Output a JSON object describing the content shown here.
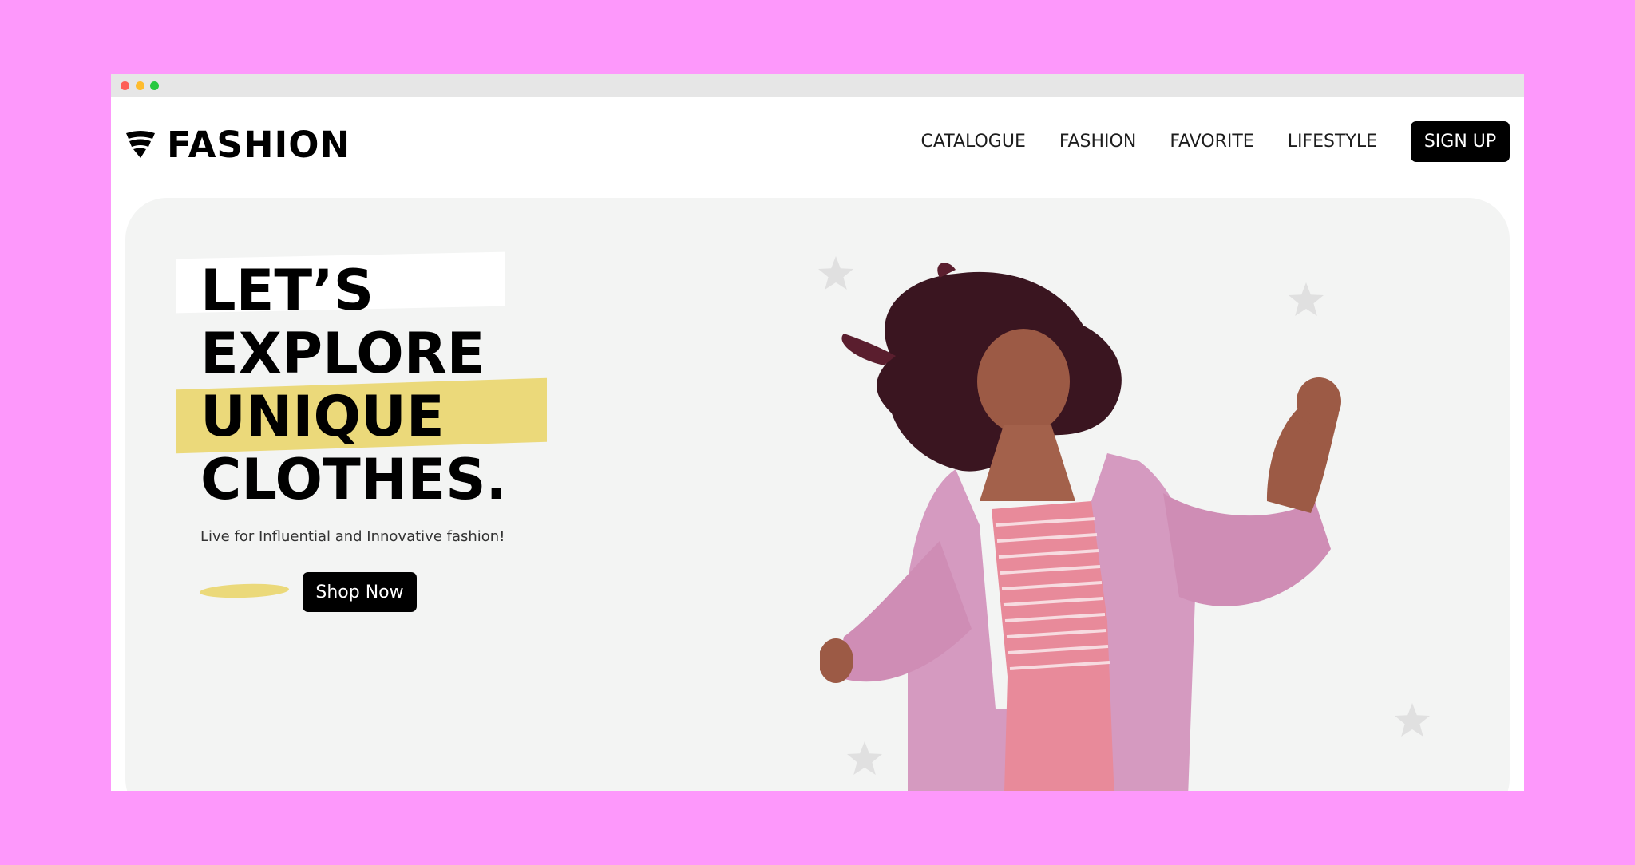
{
  "brand": {
    "name": "FASHION"
  },
  "nav": {
    "items": [
      "CATALOGUE",
      "FASHION",
      "FAVORITE",
      "LIFESTYLE"
    ],
    "signup_label": "SIGN UP"
  },
  "hero": {
    "headline": [
      "LET’S",
      "EXPLORE",
      "UNIQUE",
      "CLOTHES."
    ],
    "subtitle": "Live for Influential and Innovative fashion!",
    "cta_label": "Shop Now"
  },
  "colors": {
    "page_background": "#fd98fb",
    "hero_background": "#f3f4f3",
    "highlight_yellow": "#ebd97a",
    "button": "#000000"
  },
  "icons": [
    "traffic-light-close",
    "traffic-light-minimize",
    "traffic-light-maximize",
    "brand-logo-icon",
    "star-icon"
  ]
}
